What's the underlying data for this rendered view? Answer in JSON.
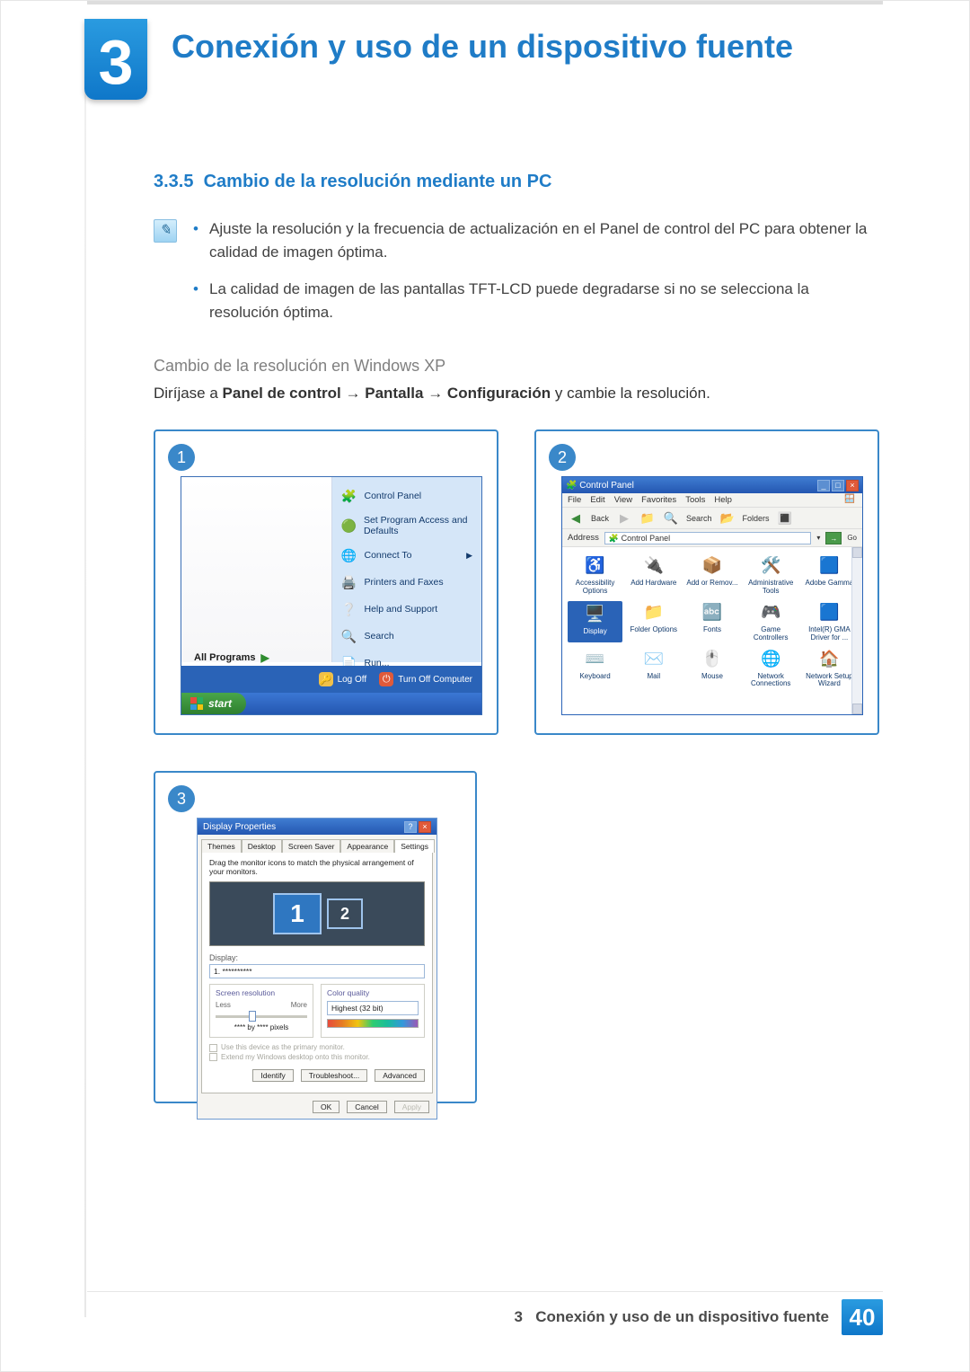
{
  "chapter": {
    "num": "3",
    "title": "Conexión y uso de un dispositivo fuente"
  },
  "section": {
    "num": "3.3.5",
    "title": "Cambio de la resolución mediante un PC"
  },
  "notes": [
    "Ajuste la resolución y la frecuencia de actualización en el Panel de control del PC para obtener la calidad de imagen óptima.",
    "La calidad de imagen de las pantallas TFT-LCD puede degradarse si no se selecciona la resolución óptima."
  ],
  "subheading": "Cambio de la resolución en Windows XP",
  "instruction": {
    "lead": "Diríjase a ",
    "p1": "Panel de control",
    "arrow1": " → ",
    "p2": "Pantalla",
    "arrow2": " → ",
    "p3": "Configuración",
    "tail": " y cambie la resolución."
  },
  "shot1": {
    "badge": "1",
    "items": [
      {
        "icon": "🧩",
        "label": "Control Panel"
      },
      {
        "icon": "🟢",
        "label": "Set Program Access and Defaults"
      },
      {
        "icon": "🌐",
        "label": "Connect To",
        "arrow": true
      },
      {
        "icon": "🖨️",
        "label": "Printers and Faxes"
      },
      {
        "icon": "❔",
        "label": "Help and Support"
      },
      {
        "icon": "🔍",
        "label": "Search"
      },
      {
        "icon": "📄",
        "label": "Run..."
      }
    ],
    "all_programs": "All Programs",
    "logoff": "Log Off",
    "turnoff": "Turn Off Computer",
    "start": "start"
  },
  "shot2": {
    "badge": "2",
    "title": "Control Panel",
    "menus": [
      "File",
      "Edit",
      "View",
      "Favorites",
      "Tools",
      "Help"
    ],
    "tb_back": "Back",
    "tb_search": "Search",
    "tb_folders": "Folders",
    "addr_label": "Address",
    "addr_value": "Control Panel",
    "go": "Go",
    "icons": [
      {
        "e": "♿",
        "t": "Accessibility Options"
      },
      {
        "e": "🔌",
        "t": "Add Hardware"
      },
      {
        "e": "📦",
        "t": "Add or Remov..."
      },
      {
        "e": "🛠️",
        "t": "Administrative Tools"
      },
      {
        "e": "🟦",
        "t": "Adobe Gamma"
      },
      {
        "e": "🖥️",
        "t": "Display",
        "sel": true
      },
      {
        "e": "📁",
        "t": "Folder Options"
      },
      {
        "e": "🔤",
        "t": "Fonts"
      },
      {
        "e": "🎮",
        "t": "Game Controllers"
      },
      {
        "e": "🟦",
        "t": "Intel(R) GMA Driver for ..."
      },
      {
        "e": "⌨️",
        "t": "Keyboard"
      },
      {
        "e": "✉️",
        "t": "Mail"
      },
      {
        "e": "🖱️",
        "t": "Mouse"
      },
      {
        "e": "🌐",
        "t": "Network Connections"
      },
      {
        "e": "🏠",
        "t": "Network Setup Wizard"
      }
    ]
  },
  "shot3": {
    "badge": "3",
    "title": "Display Properties",
    "tabs": [
      "Themes",
      "Desktop",
      "Screen Saver",
      "Appearance",
      "Settings"
    ],
    "active_tab": 4,
    "help": "Drag the monitor icons to match the physical arrangement of your monitors.",
    "mon1": "1",
    "mon2": "2",
    "display_label": "Display:",
    "display_value": "1. **********",
    "res_hd": "Screen resolution",
    "res_less": "Less",
    "res_more": "More",
    "res_val": "**** by **** pixels",
    "cq_hd": "Color quality",
    "cq_val": "Highest (32 bit)",
    "chk1": "Use this device as the primary monitor.",
    "chk2": "Extend my Windows desktop onto this monitor.",
    "btn_identify": "Identify",
    "btn_trouble": "Troubleshoot...",
    "btn_adv": "Advanced",
    "btn_ok": "OK",
    "btn_cancel": "Cancel",
    "btn_apply": "Apply"
  },
  "footer": {
    "chapter_num": "3",
    "chapter_title": "Conexión y uso de un dispositivo fuente",
    "page": "40"
  }
}
